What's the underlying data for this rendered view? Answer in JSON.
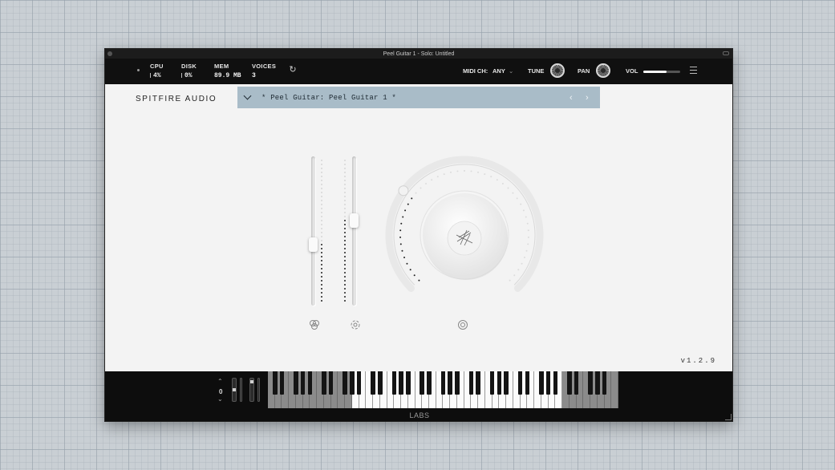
{
  "window": {
    "title": "Peel Guitar 1 - Solo: Untitled"
  },
  "toolbar": {
    "cpu": {
      "label": "CPU",
      "value": "4%"
    },
    "disk": {
      "label": "DISK",
      "value": "0%"
    },
    "mem": {
      "label": "MEM",
      "value": "89.9 MB"
    },
    "voices": {
      "label": "VOICES",
      "value": "3"
    },
    "refresh_icon": "refresh-icon",
    "midi_label": "MIDI CH:",
    "midi_value": "ANY",
    "tune_label": "TUNE",
    "pan_label": "PAN",
    "vol_label": "VOL",
    "vol_level": 0.62
  },
  "header": {
    "brand": "SPITFIRE AUDIO",
    "preset_name": "* Peel Guitar: Peel Guitar 1 *",
    "preset_bg": "#a9bcc8"
  },
  "controls": {
    "fader1_level": 0.4,
    "fader2_level": 0.58,
    "dial_level": 0.3,
    "icons": [
      "expression-icon",
      "dynamics-icon",
      "reverb-icon"
    ]
  },
  "footer": {
    "version": "v1.2.9",
    "octave": "0",
    "brand_footer": "LABS"
  }
}
